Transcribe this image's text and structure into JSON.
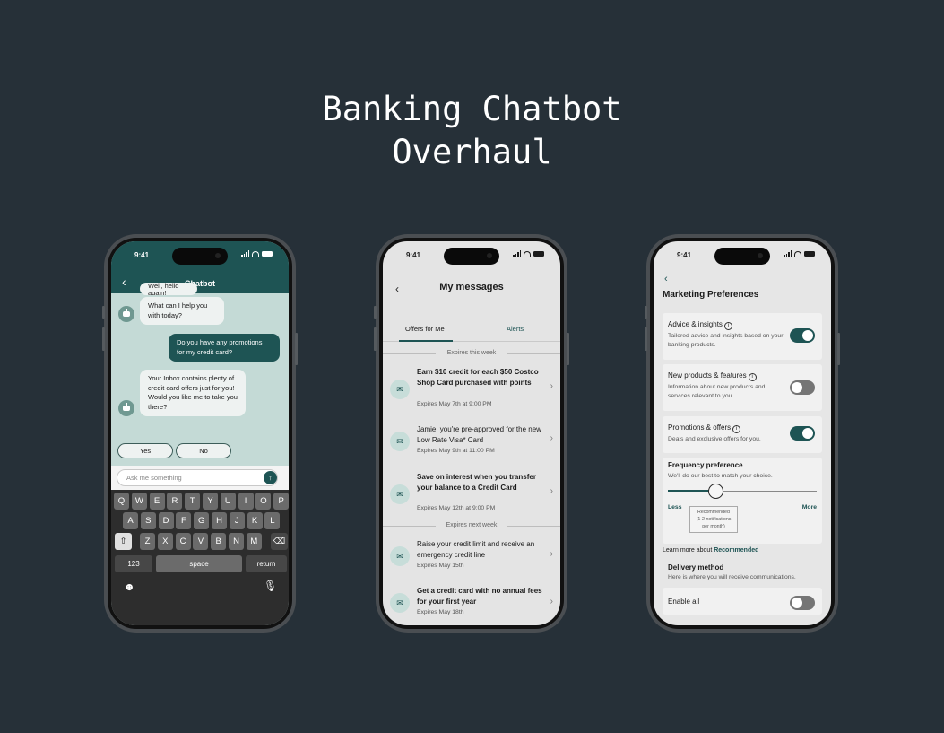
{
  "page": {
    "title_line1": "Banking Chatbot",
    "title_line2": "Overhaul"
  },
  "status": {
    "time": "9:41"
  },
  "chatbot": {
    "title": "Chatbot",
    "messages": [
      {
        "from": "bot",
        "text": "Well, hello again!"
      },
      {
        "from": "bot",
        "text": "What can I help you with today?"
      },
      {
        "from": "user",
        "text": "Do you have any promotions for my credit card?"
      },
      {
        "from": "bot",
        "text": "Your Inbox contains plenty of credit card offers just for you! Would you like me to take you there?"
      }
    ],
    "quick_replies": [
      "Yes",
      "No"
    ],
    "input_placeholder": "Ask me something",
    "keyboard": {
      "row1": [
        "Q",
        "W",
        "E",
        "R",
        "T",
        "Y",
        "U",
        "I",
        "O",
        "P"
      ],
      "row2": [
        "A",
        "S",
        "D",
        "F",
        "G",
        "H",
        "J",
        "K",
        "L"
      ],
      "row3": [
        "Z",
        "X",
        "C",
        "V",
        "B",
        "N",
        "M"
      ],
      "numbers_key": "123",
      "space_key": "space",
      "return_key": "return"
    }
  },
  "messages": {
    "title": "My messages",
    "tabs": [
      "Offers for Me",
      "Alerts"
    ],
    "sections": [
      "Expires this week",
      "Expires next week"
    ],
    "items": [
      {
        "title": "Earn $10 credit for each $50 Costco Shop Card purchased with points",
        "date": "Expires May 7th at 9:00 PM",
        "unread": true
      },
      {
        "title": "Jamie, you're pre-approved for the new Low Rate Visa* Card",
        "date": "Expires May 9th at 11:00 PM",
        "unread": false
      },
      {
        "title": "Save on interest when you transfer your balance to a Credit Card",
        "date": "Expires May 12th at 9:00 PM",
        "unread": true
      },
      {
        "title": "Raise your credit limit and receive an emergency credit line",
        "date": "Expires May 15th",
        "unread": false
      },
      {
        "title": "Get a credit card with no annual fees for your first year",
        "date": "Expires May 18th",
        "unread": true
      }
    ]
  },
  "preferences": {
    "title": "Marketing Preferences",
    "cards": [
      {
        "title": "Advice & insights",
        "desc": "Tailored advice and insights based on your banking products.",
        "enabled": true
      },
      {
        "title": "New products & features",
        "desc": "Information about new products and services relevant to you.",
        "enabled": false
      },
      {
        "title": "Promotions & offers",
        "desc": "Deals and exclusive offers for you.",
        "enabled": true
      }
    ],
    "frequency": {
      "title": "Frequency preference",
      "desc": "We'll do our best to match your choice.",
      "less": "Less",
      "more": "More",
      "value": 0.32,
      "tooltip_line1": "Recommended",
      "tooltip_line2": "(1-2 notifications per month)"
    },
    "learn_more_prefix": "Learn more about",
    "learn_more_link": "Recommended",
    "delivery_title": "Delivery method",
    "delivery_desc": "Here is where you will receive communications.",
    "enable_all": "Enable all",
    "enable_all_on": false
  }
}
